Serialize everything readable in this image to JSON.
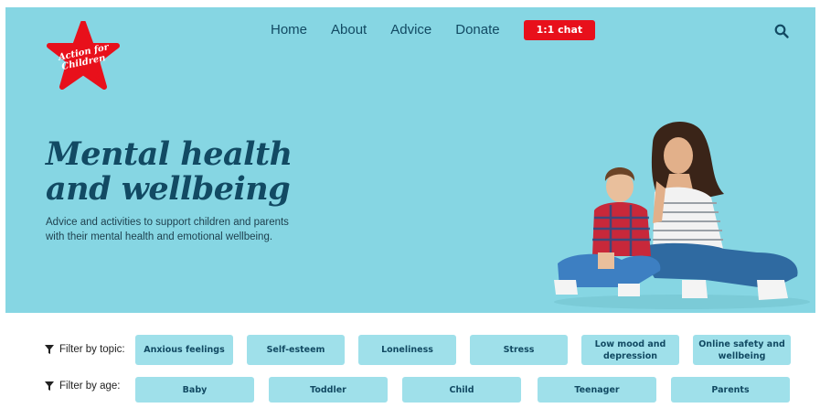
{
  "brand": {
    "logo_line1": "Action for",
    "logo_line2": "Children",
    "logo_color": "#e8101b"
  },
  "nav": {
    "items": [
      {
        "label": "Home"
      },
      {
        "label": "About"
      },
      {
        "label": "Advice"
      },
      {
        "label": "Donate"
      }
    ],
    "chat_label": "1:1 chat",
    "search_icon": "search-icon"
  },
  "hero": {
    "title_line1": "Mental health",
    "title_line2": "and wellbeing",
    "subtitle": "Advice and activities to support children and parents with their mental health and emotional wellbeing.",
    "background": "#86d6e3",
    "title_color": "#124a63"
  },
  "filters": {
    "topic_label": "Filter by topic:",
    "topics": [
      {
        "label": "Anxious feelings"
      },
      {
        "label": "Self-esteem"
      },
      {
        "label": "Loneliness"
      },
      {
        "label": "Stress"
      },
      {
        "label": "Low mood and depression"
      },
      {
        "label": "Online safety and wellbeing"
      }
    ],
    "age_label": "Filter by age:",
    "ages": [
      {
        "label": "Baby"
      },
      {
        "label": "Toddler"
      },
      {
        "label": "Child"
      },
      {
        "label": "Teenager"
      },
      {
        "label": "Parents"
      }
    ],
    "chip_color": "#9fe0ea"
  }
}
